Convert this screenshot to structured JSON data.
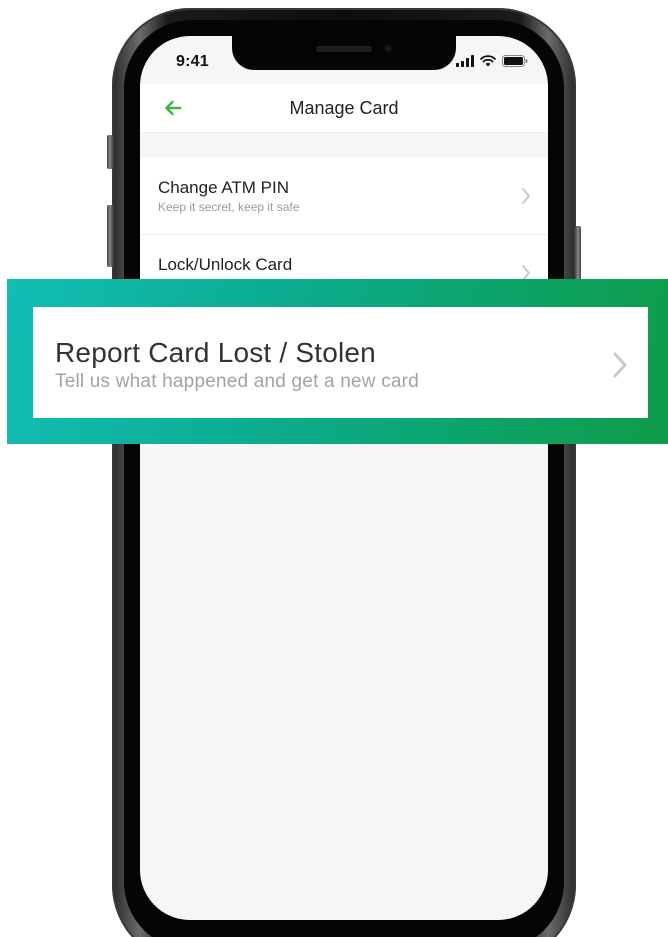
{
  "status_bar": {
    "time": "9:41",
    "icons": [
      "cellular-signal-icon",
      "wifi-icon",
      "battery-icon"
    ]
  },
  "nav": {
    "back_icon": "arrow-left-icon",
    "title": "Manage Card"
  },
  "colors": {
    "accent_green": "#3fb54a",
    "callout_gradient_start": "#12bdb5",
    "callout_gradient_end": "#0e9c48"
  },
  "list": {
    "items": [
      {
        "title": "Change ATM PIN",
        "subtitle": "Keep it secret, keep it safe"
      },
      {
        "title": "Lock/Unlock Card",
        "subtitle": ""
      }
    ]
  },
  "callout": {
    "title": "Report Card Lost / Stolen",
    "subtitle": "Tell us what happened and get a new card"
  }
}
